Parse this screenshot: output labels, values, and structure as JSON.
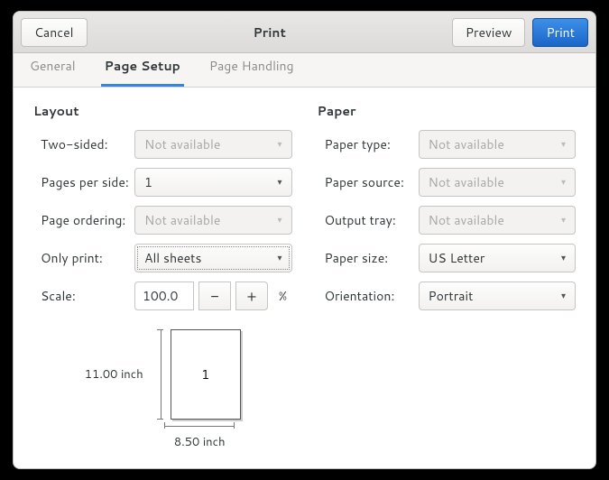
{
  "titlebar": {
    "cancel": "Cancel",
    "title": "Print",
    "preview": "Preview",
    "print": "Print"
  },
  "tabs": {
    "general": "General",
    "page_setup": "Page Setup",
    "page_handling": "Page Handling",
    "active": "page_setup"
  },
  "layout": {
    "heading": "Layout",
    "two_sided_label": "Two-sided:",
    "two_sided_value": "Not available",
    "pages_per_side_label": "Pages per side:",
    "pages_per_side_value": "1",
    "page_ordering_label": "Page ordering:",
    "page_ordering_value": "Not available",
    "only_print_label": "Only print:",
    "only_print_value": "All sheets",
    "scale_label": "Scale:",
    "scale_value": "100.0",
    "scale_suffix": "%"
  },
  "paper": {
    "heading": "Paper",
    "paper_type_label": "Paper type:",
    "paper_type_value": "Not available",
    "paper_source_label": "Paper source:",
    "paper_source_value": "Not available",
    "output_tray_label": "Output tray:",
    "output_tray_value": "Not available",
    "paper_size_label": "Paper size:",
    "paper_size_value": "US Letter",
    "orientation_label": "Orientation:",
    "orientation_value": "Portrait"
  },
  "preview": {
    "page_number": "1",
    "height_label": "11.00 inch",
    "width_label": "8.50 inch"
  }
}
